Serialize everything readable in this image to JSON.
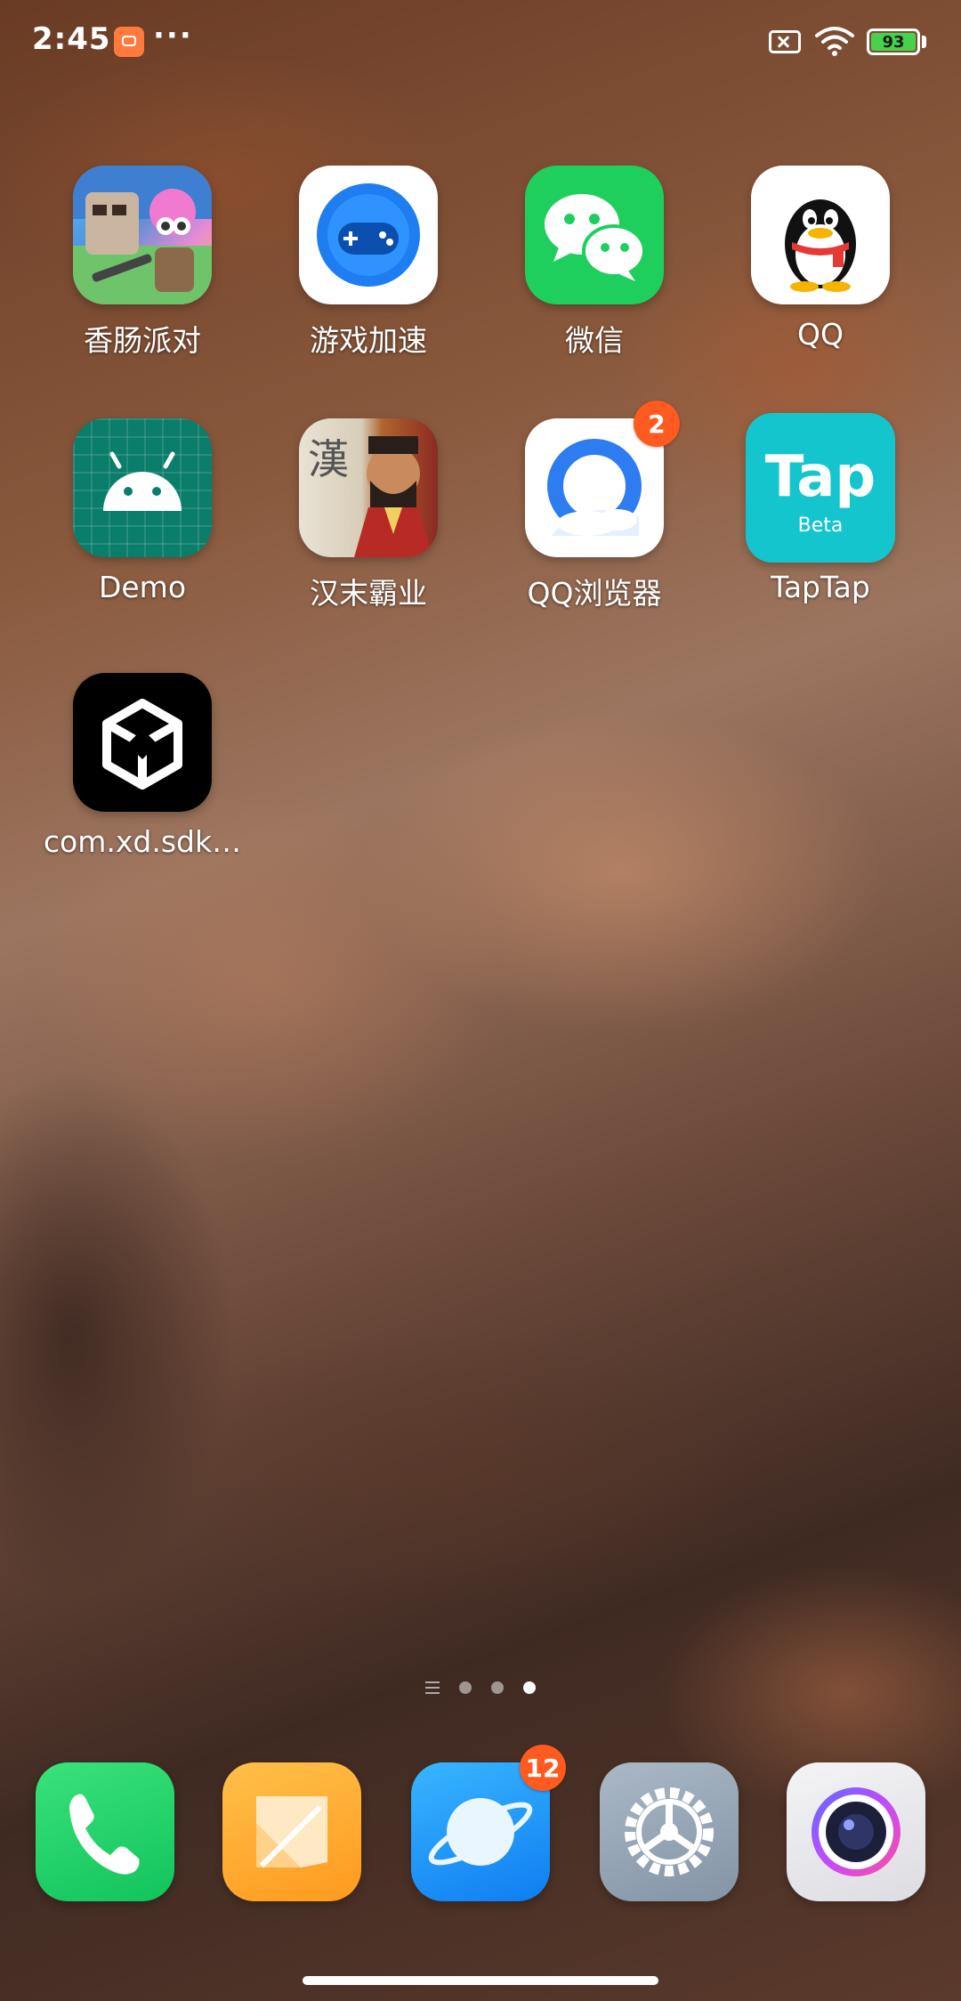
{
  "status_bar": {
    "time": "2:45",
    "more": "···",
    "battery_level": "93",
    "battery_color": "#48d24a"
  },
  "apps": [
    {
      "label": "香肠派对",
      "icon": "sausage-party-icon"
    },
    {
      "label": "游戏加速",
      "icon": "game-accelerator-icon"
    },
    {
      "label": "微信",
      "icon": "wechat-icon"
    },
    {
      "label": "QQ",
      "icon": "qq-penguin-icon"
    },
    {
      "label": "Demo",
      "icon": "android-icon"
    },
    {
      "label": "汉末霸业",
      "icon": "hanmo-baye-icon"
    },
    {
      "label": "QQ浏览器",
      "icon": "qq-browser-icon",
      "badge": "2"
    },
    {
      "label": "TapTap",
      "icon": "taptap-icon",
      "icon_text": "Tap",
      "icon_subtext": "Beta"
    },
    {
      "label": "com.xd.sdk…",
      "icon": "unity-icon"
    }
  ],
  "hanmo_icon_glyph": "漢",
  "page_indicator": {
    "pages": 3,
    "active": 3
  },
  "dock": [
    {
      "icon": "phone-icon"
    },
    {
      "icon": "notes-icon"
    },
    {
      "icon": "browser-icon",
      "badge": "12"
    },
    {
      "icon": "settings-icon"
    },
    {
      "icon": "camera-icon"
    }
  ]
}
